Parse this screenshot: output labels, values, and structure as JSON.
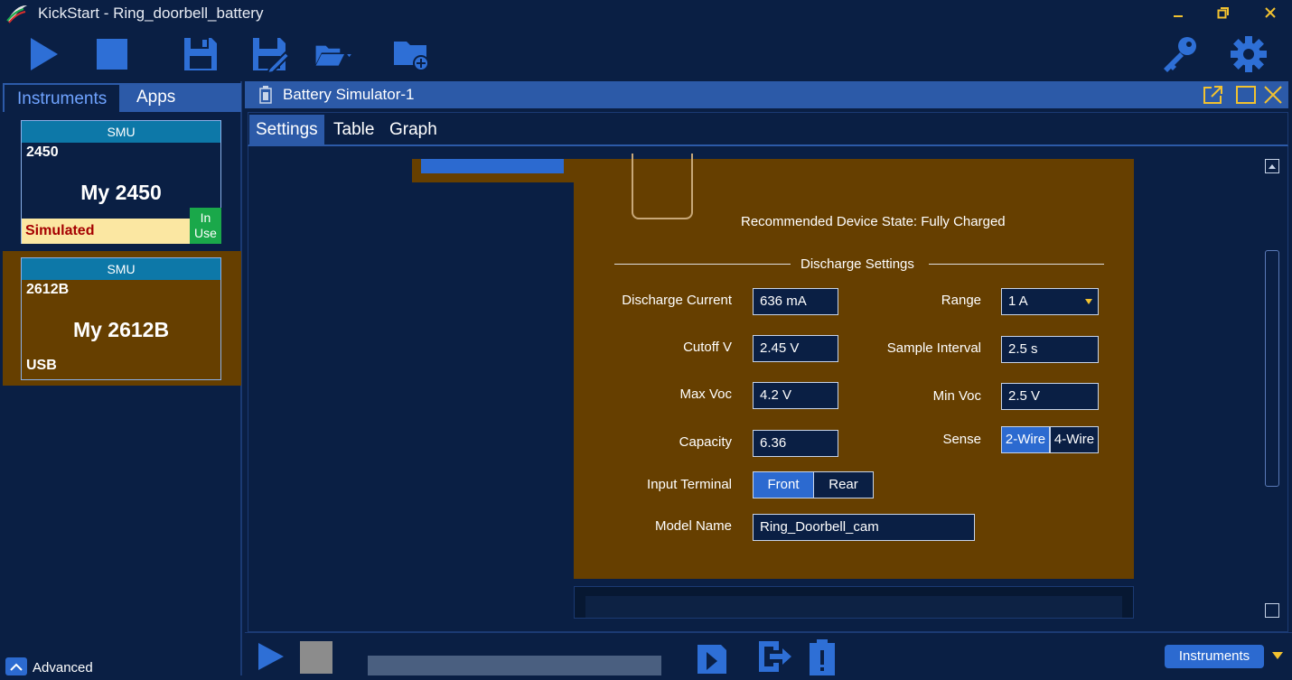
{
  "window": {
    "title": "KickStart - Ring_doorbell_battery",
    "minimize_icon": "minimize-icon",
    "restore_icon": "restore-icon",
    "close_icon": "close-icon"
  },
  "toolbar": {
    "icons": [
      "run-icon",
      "stop-icon",
      "save-icon",
      "save-as-icon",
      "open-folder-icon",
      "new-folder-icon",
      "key-icon",
      "gear-icon"
    ]
  },
  "left_panel": {
    "tabs": [
      {
        "label": "Instruments"
      },
      {
        "label": "Apps"
      }
    ],
    "cards": [
      {
        "type": "SMU",
        "model": "2450",
        "name": "My 2450",
        "status": "Simulated",
        "badge": "In Use"
      },
      {
        "type": "SMU",
        "model": "2612B",
        "name": "My 2612B",
        "status": "USB"
      }
    ],
    "advanced_label": "Advanced"
  },
  "document": {
    "title": "Battery Simulator-1",
    "tabs": [
      {
        "label": "Settings"
      },
      {
        "label": "Table"
      },
      {
        "label": "Graph"
      }
    ]
  },
  "settings": {
    "recommended_state": "Recommended Device State: Fully Charged",
    "section_title": "Discharge Settings",
    "discharge_current": {
      "label": "Discharge Current",
      "value": "636 mA"
    },
    "range": {
      "label": "Range",
      "value": "1 A"
    },
    "cutoff_v": {
      "label": "Cutoff V",
      "value": "2.45 V"
    },
    "sample_interval": {
      "label": "Sample Interval",
      "value": "2.5 s"
    },
    "max_voc": {
      "label": "Max Voc",
      "value": "4.2 V"
    },
    "min_voc": {
      "label": "Min Voc",
      "value": "2.5 V"
    },
    "capacity": {
      "label": "Capacity",
      "value": "6.36"
    },
    "sense": {
      "label": "Sense",
      "options": [
        "2-Wire",
        "4-Wire"
      ],
      "selected": "2-Wire"
    },
    "input_terminal": {
      "label": "Input Terminal",
      "options": [
        "Front",
        "Rear"
      ],
      "selected": "Front"
    },
    "model_name": {
      "label": "Model Name",
      "value": "Ring_Doorbell_cam"
    }
  },
  "bottom_bar": {
    "instruments_button": "Instruments"
  },
  "colors": {
    "background": "#0a1f44",
    "accent": "#2c5aa8",
    "settings_panel": "#663f00",
    "icon_blue": "#2e6fd6",
    "status_simulated_bg": "#fbe7a2",
    "status_simulated_text": "#a50000",
    "in_use_green": "#1aa84a",
    "card_selected_bg": "#663f00"
  }
}
